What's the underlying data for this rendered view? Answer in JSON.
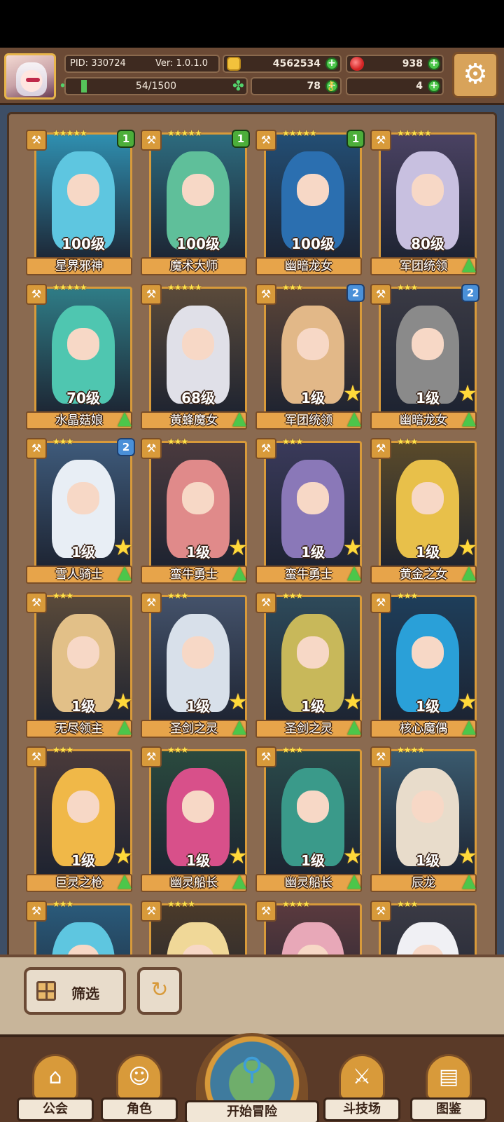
{
  "header": {
    "pid": "PID: 330724",
    "version": "Ver: 1.0.1.0",
    "coins": "4562534",
    "gems": "938",
    "progress": "54/1500",
    "progress_fraction": 0.036,
    "clovers": "78",
    "keys": "4"
  },
  "cards": [
    {
      "name": "星界邪神",
      "level": "100级",
      "badge": "1",
      "badge_color": "green",
      "stars": "★★★★★",
      "art": "#2f8fb0",
      "hair": "#5ec6e0",
      "indicator": "none"
    },
    {
      "name": "魔术大师",
      "level": "100级",
      "badge": "1",
      "badge_color": "green",
      "stars": "★★★★★",
      "art": "#2d6b7e",
      "hair": "#5fbf9a",
      "indicator": "none"
    },
    {
      "name": "幽暗龙女",
      "level": "100级",
      "badge": "1",
      "badge_color": "green",
      "stars": "★★★★★",
      "art": "#234e74",
      "hair": "#2b6fb0",
      "indicator": "none"
    },
    {
      "name": "军团统领",
      "level": "80级",
      "badge": "",
      "badge_color": "",
      "stars": "★★★★★",
      "art": "#4a4262",
      "hair": "#c8c0e0",
      "indicator": "arrow"
    },
    {
      "name": "水晶菇娘",
      "level": "70级",
      "badge": "",
      "badge_color": "",
      "stars": "★★★★★",
      "art": "#2f7c86",
      "hair": "#4fc6b0",
      "indicator": "arrow"
    },
    {
      "name": "黄蜂魔女",
      "level": "68级",
      "badge": "",
      "badge_color": "",
      "stars": "★★★★★",
      "art": "#5a4a3a",
      "hair": "#e0e0e8",
      "indicator": "arrow"
    },
    {
      "name": "军团统领",
      "level": "1级",
      "badge": "2",
      "badge_color": "blue",
      "stars": "★★★",
      "art": "#5a4438",
      "hair": "#e2b888",
      "indicator": "star-arrow"
    },
    {
      "name": "幽暗龙女",
      "level": "1级",
      "badge": "2",
      "badge_color": "blue",
      "stars": "★★★",
      "art": "#3a3a44",
      "hair": "#8a8a8a",
      "indicator": "star-arrow"
    },
    {
      "name": "雪人骑士",
      "level": "1级",
      "badge": "2",
      "badge_color": "blue",
      "stars": "★★★",
      "art": "#3e5a7a",
      "hair": "#e8eef5",
      "indicator": "star-arrow"
    },
    {
      "name": "蛮牛勇士",
      "level": "1级",
      "badge": "",
      "badge_color": "",
      "stars": "★★★",
      "art": "#4a3a3e",
      "hair": "#e08a8a",
      "indicator": "star-arrow"
    },
    {
      "name": "蛮牛勇士",
      "level": "1级",
      "badge": "",
      "badge_color": "",
      "stars": "★★★",
      "art": "#3a3a5a",
      "hair": "#8a78b8",
      "indicator": "star-arrow"
    },
    {
      "name": "黄金之女",
      "level": "1级",
      "badge": "",
      "badge_color": "",
      "stars": "★★★",
      "art": "#5a4a2a",
      "hair": "#e8c04a",
      "indicator": "star-arrow"
    },
    {
      "name": "无尽领主",
      "level": "1级",
      "badge": "",
      "badge_color": "",
      "stars": "★★★",
      "art": "#5a4a3a",
      "hair": "#e2c088",
      "indicator": "star-arrow"
    },
    {
      "name": "圣剑之灵",
      "level": "1级",
      "badge": "",
      "badge_color": "",
      "stars": "★★★",
      "art": "#44526a",
      "hair": "#d8e0ea",
      "indicator": "star-arrow"
    },
    {
      "name": "圣剑之灵",
      "level": "1级",
      "badge": "",
      "badge_color": "",
      "stars": "★★★",
      "art": "#2e4a5a",
      "hair": "#c8b85a",
      "indicator": "star-arrow"
    },
    {
      "name": "核心魔偶",
      "level": "1级",
      "badge": "",
      "badge_color": "",
      "stars": "★★★",
      "art": "#1e3e5a",
      "hair": "#2aa0d8",
      "indicator": "star-arrow"
    },
    {
      "name": "巨灵之枪",
      "level": "1级",
      "badge": "",
      "badge_color": "",
      "stars": "★★★",
      "art": "#4a3a3a",
      "hair": "#f0b848",
      "indicator": "star-arrow"
    },
    {
      "name": "幽灵船长",
      "level": "1级",
      "badge": "",
      "badge_color": "",
      "stars": "★★★",
      "art": "#2a4a3e",
      "hair": "#d8508a",
      "indicator": "star-arrow"
    },
    {
      "name": "幽灵船长",
      "level": "1级",
      "badge": "",
      "badge_color": "",
      "stars": "★★★",
      "art": "#2a4a4a",
      "hair": "#3a9a8a",
      "indicator": "star-arrow"
    },
    {
      "name": "辰龙",
      "level": "1级",
      "badge": "",
      "badge_color": "",
      "stars": "★★★★",
      "art": "#3a5a6e",
      "hair": "#e8dccb",
      "indicator": "star-arrow"
    },
    {
      "name": "",
      "level": "",
      "badge": "",
      "badge_color": "",
      "stars": "★★★",
      "art": "#2a5a7a",
      "hair": "#5ec6e0",
      "indicator": "none"
    },
    {
      "name": "",
      "level": "",
      "badge": "",
      "badge_color": "",
      "stars": "★★★★",
      "art": "#4a3a2a",
      "hair": "#f0d898",
      "indicator": "none"
    },
    {
      "name": "",
      "level": "",
      "badge": "",
      "badge_color": "",
      "stars": "★★★★",
      "art": "#5a3a3e",
      "hair": "#e8a8b8",
      "indicator": "none"
    },
    {
      "name": "",
      "level": "",
      "badge": "",
      "badge_color": "",
      "stars": "★★★",
      "art": "#3a3a44",
      "hair": "#f0f0f4",
      "indicator": "none"
    }
  ],
  "toolbar": {
    "filter_label": "筛选",
    "refresh_icon": "refresh-icon"
  },
  "nav": {
    "guild": "公会",
    "character": "角色",
    "adventure": "开始冒险",
    "arena": "斗技场",
    "codex": "图鉴"
  }
}
